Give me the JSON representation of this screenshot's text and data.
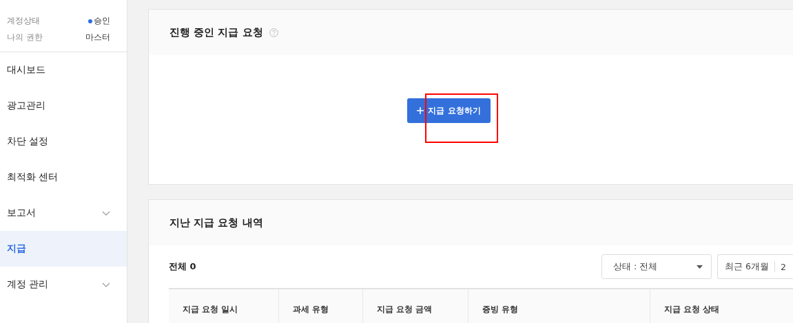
{
  "sidebar": {
    "account": [
      {
        "label": "계정상태",
        "value": "승인",
        "color": "#2f6de1"
      },
      {
        "label": "나의 권한",
        "value": "마스터"
      }
    ],
    "items": [
      {
        "label": "대시보드",
        "selected": false,
        "expandable": false
      },
      {
        "label": "광고관리",
        "selected": false,
        "expandable": false
      },
      {
        "label": "차단 설정",
        "selected": false,
        "expandable": false
      },
      {
        "label": "최적화 센터",
        "selected": false,
        "expandable": false
      },
      {
        "label": "보고서",
        "selected": false,
        "expandable": true
      },
      {
        "label": "지급",
        "selected": true,
        "expandable": false
      },
      {
        "label": "계정 관리",
        "selected": false,
        "expandable": true
      }
    ]
  },
  "current_requests": {
    "title": "진행 중인 지급 요청",
    "button": "지급 요청하기",
    "highlighted": true
  },
  "past_requests": {
    "title": "지난 지급 요청 내역",
    "total": "전체 0",
    "status_filter": "상태 : 전체",
    "period_filter": "최근 6개월",
    "date_start": "2",
    "table": {
      "columns": [
        "지급 요청 일시",
        "과세 유형",
        "지급 요청 금액",
        "증빙 유형",
        "지급 요청 상태"
      ]
    }
  }
}
